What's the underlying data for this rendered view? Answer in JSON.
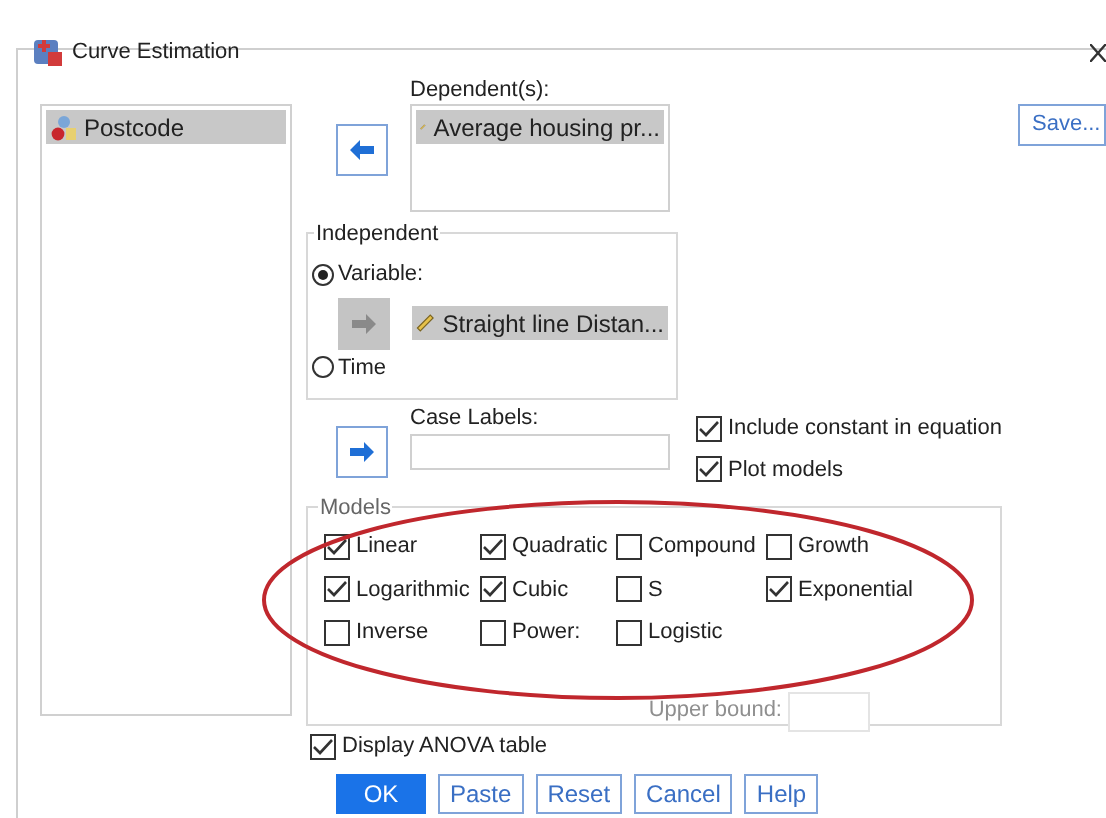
{
  "window": {
    "title": "Curve Estimation"
  },
  "variables": [
    {
      "label": "Postcode",
      "selected": true
    }
  ],
  "dependent": {
    "label": "Dependent(s):",
    "items": [
      "Average housing pr..."
    ]
  },
  "save_button": "Save...",
  "independent": {
    "title": "Independent",
    "options": [
      {
        "label": "Variable:",
        "selected": true
      },
      {
        "label": "Time",
        "selected": false
      }
    ],
    "variable": "Straight line Distan..."
  },
  "case_labels": {
    "label": "Case Labels:"
  },
  "options": [
    {
      "label": "Include constant in equation",
      "checked": true
    },
    {
      "label": "Plot models",
      "checked": true
    }
  ],
  "models": {
    "title": "Models",
    "items": [
      {
        "label": "Linear",
        "checked": true
      },
      {
        "label": "Quadratic",
        "checked": true
      },
      {
        "label": "Compound",
        "checked": false
      },
      {
        "label": "Growth",
        "checked": false
      },
      {
        "label": "Logarithmic",
        "checked": true
      },
      {
        "label": "Cubic",
        "checked": true
      },
      {
        "label": "S",
        "checked": false
      },
      {
        "label": "Exponential",
        "checked": true
      },
      {
        "label": "Inverse",
        "checked": false
      },
      {
        "label": "Power:",
        "checked": false
      },
      {
        "label": "Logistic",
        "checked": false
      }
    ],
    "upper_bound": {
      "label": "Upper bound:",
      "disabled": true
    }
  },
  "display_anova": {
    "label": "Display ANOVA table",
    "checked": true
  },
  "buttons": [
    {
      "label": "OK",
      "default": true
    },
    {
      "label": "Paste",
      "default": false
    },
    {
      "label": "Reset",
      "default": false
    },
    {
      "label": "Cancel",
      "default": false
    },
    {
      "label": "Help",
      "default": false
    }
  ]
}
